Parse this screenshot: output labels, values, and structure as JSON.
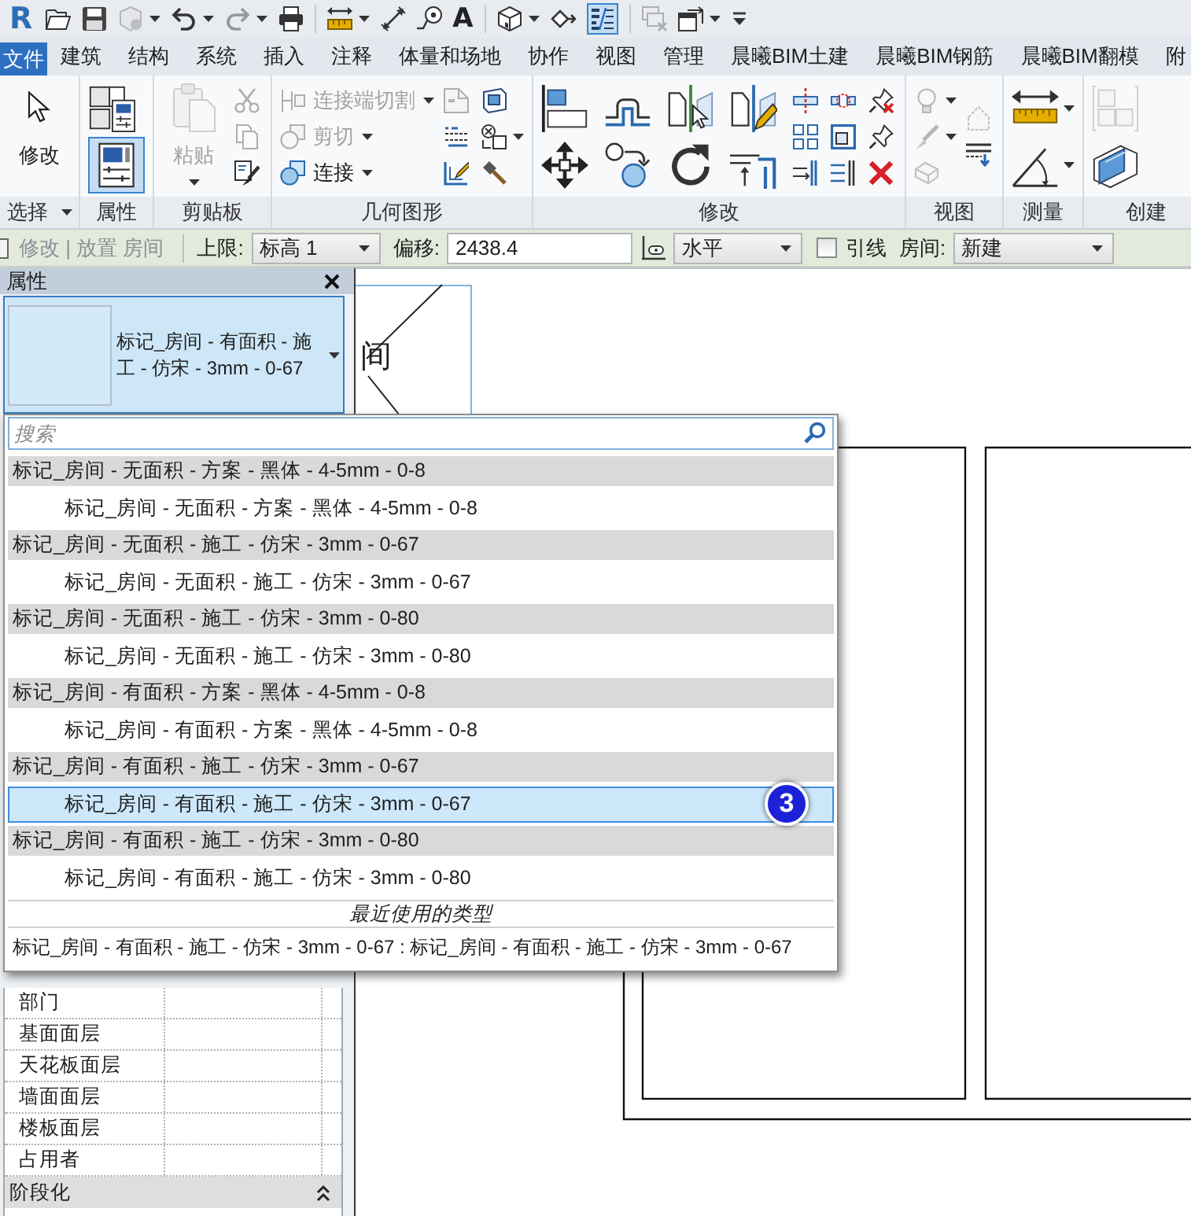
{
  "quick_access_toolbar": {
    "app_glyph": "R",
    "groups": [
      [
        {
          "disabled": false,
          "menu": false,
          "on": false
        },
        {
          "disabled": false,
          "menu": false,
          "on": false
        },
        {
          "disabled": true,
          "menu": true,
          "on": false
        },
        {
          "disabled": false,
          "menu": true,
          "on": false
        },
        {
          "disabled": true,
          "menu": true,
          "on": false
        },
        {
          "disabled": false,
          "menu": false,
          "on": false
        }
      ],
      [
        {
          "disabled": false,
          "menu": true,
          "on": false
        },
        {
          "disabled": false,
          "menu": false,
          "on": false
        },
        {
          "disabled": false,
          "menu": false,
          "on": false
        },
        {
          "glyph": "A",
          "disabled": false,
          "menu": false,
          "on": false
        }
      ],
      [
        {
          "disabled": false,
          "menu": true,
          "on": false
        },
        {
          "disabled": false,
          "menu": false,
          "on": false
        },
        {
          "disabled": false,
          "menu": false,
          "on": true
        }
      ],
      [
        {
          "disabled": true,
          "menu": false,
          "on": false
        },
        {
          "disabled": false,
          "menu": true,
          "on": false
        },
        {
          "disabled": false,
          "menu": false,
          "on": false
        }
      ]
    ]
  },
  "ribbon_tabs": [
    {
      "label": "文件",
      "kind": "application"
    },
    {
      "label": "建筑",
      "kind": "tab"
    },
    {
      "label": "结构",
      "kind": "tab"
    },
    {
      "label": "系统",
      "kind": "tab"
    },
    {
      "label": "插入",
      "kind": "tab"
    },
    {
      "label": "注释",
      "kind": "tab"
    },
    {
      "label": "体量和场地",
      "kind": "tab"
    },
    {
      "label": "协作",
      "kind": "tab"
    },
    {
      "label": "视图",
      "kind": "tab"
    },
    {
      "label": "管理",
      "kind": "tab"
    },
    {
      "label": "晨曦BIM土建",
      "kind": "tab"
    },
    {
      "label": "晨曦BIM钢筋",
      "kind": "tab"
    },
    {
      "label": "晨曦BIM翻模",
      "kind": "tab"
    },
    {
      "label": "附",
      "kind": "tab"
    }
  ],
  "ribbon_panels": [
    {
      "title": "选择",
      "menu": true,
      "tools": [
        {
          "kind": "large",
          "label": "修改",
          "disabled": false,
          "menu": false
        }
      ]
    },
    {
      "title": "属性",
      "menu": false,
      "tools": [
        {
          "kind": "medium",
          "disabled": false,
          "menu": false,
          "on": false
        },
        {
          "kind": "medium",
          "disabled": false,
          "menu": false,
          "on": true
        }
      ]
    },
    {
      "title": "剪贴板",
      "menu": false,
      "tools": [
        {
          "kind": "large",
          "label": "粘贴",
          "disabled": true,
          "menu": true
        },
        {
          "kind": "small",
          "disabled": true,
          "menu": false
        },
        {
          "kind": "small",
          "disabled": true,
          "menu": false
        },
        {
          "kind": "small",
          "disabled": false,
          "menu": false
        }
      ]
    },
    {
      "title": "几何图形",
      "menu": false,
      "tools": [
        {
          "kind": "small",
          "label": "连接端切割",
          "disabled": true,
          "menu": true
        },
        {
          "kind": "small",
          "label": "剪切",
          "disabled": true,
          "menu": true
        },
        {
          "kind": "small",
          "label": "连接",
          "disabled": false,
          "menu": true
        },
        {
          "kind": "small",
          "disabled": true,
          "menu": false
        },
        {
          "kind": "small",
          "disabled": false,
          "menu": false
        },
        {
          "kind": "small",
          "disabled": false,
          "menu": false
        },
        {
          "kind": "small",
          "disabled": false,
          "menu": false
        },
        {
          "kind": "small",
          "disabled": false,
          "menu": true
        },
        {
          "kind": "small",
          "disabled": false,
          "menu": false
        }
      ]
    },
    {
      "title": "修改",
      "menu": false,
      "tools": [
        {
          "kind": "medium",
          "disabled": false,
          "menu": false
        },
        {
          "kind": "medium",
          "disabled": false,
          "menu": false
        },
        {
          "kind": "medium",
          "disabled": false,
          "menu": false
        },
        {
          "kind": "medium",
          "disabled": false,
          "menu": false
        },
        {
          "kind": "medium",
          "disabled": false,
          "menu": false
        },
        {
          "kind": "medium",
          "disabled": false,
          "menu": false
        },
        {
          "kind": "medium",
          "disabled": false,
          "menu": false
        },
        {
          "kind": "medium",
          "disabled": false,
          "menu": false
        },
        {
          "kind": "small",
          "disabled": false,
          "menu": false
        },
        {
          "kind": "small",
          "disabled": false,
          "menu": false
        },
        {
          "kind": "small",
          "disabled": false,
          "menu": false
        },
        {
          "kind": "small",
          "disabled": false,
          "menu": false
        },
        {
          "kind": "small",
          "disabled": false,
          "menu": false
        },
        {
          "kind": "small",
          "disabled": false,
          "menu": false
        },
        {
          "kind": "small",
          "disabled": false,
          "menu": false
        },
        {
          "kind": "small",
          "disabled": false,
          "menu": false
        },
        {
          "kind": "small",
          "disabled": false,
          "menu": false
        }
      ]
    },
    {
      "title": "视图",
      "menu": false,
      "tools": [
        {
          "kind": "small",
          "disabled": true,
          "menu": true
        },
        {
          "kind": "small",
          "disabled": true,
          "menu": true
        },
        {
          "kind": "small",
          "disabled": true,
          "menu": false
        },
        {
          "kind": "small",
          "disabled": true,
          "menu": false
        },
        {
          "kind": "small",
          "disabled": false,
          "menu": false
        }
      ]
    },
    {
      "title": "测量",
      "menu": false,
      "tools": [
        {
          "kind": "medium",
          "disabled": false,
          "menu": true
        },
        {
          "kind": "medium",
          "disabled": false,
          "menu": true
        }
      ]
    },
    {
      "title": "创建",
      "menu": false,
      "tools": [
        {
          "kind": "medium",
          "disabled": true,
          "menu": false
        },
        {
          "kind": "medium",
          "disabled": false,
          "menu": false
        }
      ]
    }
  ],
  "options_bar": {
    "context": "修改 | 放置 房间",
    "controls": [
      {
        "kind": "dropdown",
        "label": "上限:",
        "value": "标高 1"
      },
      {
        "kind": "input",
        "label": "偏移:",
        "value": "2438.4"
      },
      {
        "kind": "icon-dropdown",
        "value": "水平"
      },
      {
        "kind": "checkbox",
        "label": "引线",
        "checked": false
      },
      {
        "kind": "dropdown",
        "label": "房间:",
        "value": "新建"
      }
    ]
  },
  "properties": {
    "title": "属性",
    "type_selector": {
      "text": "标记_房间 - 有面积 - 施工 - 仿宋 - 3mm - 0-67",
      "expanded": true,
      "search": {
        "placeholder": "搜索"
      },
      "families": [
        {
          "label": "标记_房间 - 无面积 - 方案 - 黑体 - 4-5mm - 0-8",
          "types": [
            {
              "label": "标记_房间 - 无面积 - 方案 - 黑体 - 4-5mm - 0-8",
              "selected": false
            }
          ]
        },
        {
          "label": "标记_房间 - 无面积 - 施工 - 仿宋 - 3mm - 0-67",
          "types": [
            {
              "label": "标记_房间 - 无面积 - 施工 - 仿宋 - 3mm - 0-67",
              "selected": false
            }
          ]
        },
        {
          "label": "标记_房间 - 无面积 - 施工 - 仿宋 - 3mm - 0-80",
          "types": [
            {
              "label": "标记_房间 - 无面积 - 施工 - 仿宋 - 3mm - 0-80",
              "selected": false
            }
          ]
        },
        {
          "label": "标记_房间 - 有面积 - 方案 - 黑体 - 4-5mm - 0-8",
          "types": [
            {
              "label": "标记_房间 - 有面积 - 方案 - 黑体 - 4-5mm - 0-8",
              "selected": false
            }
          ]
        },
        {
          "label": "标记_房间 - 有面积 - 施工 - 仿宋 - 3mm - 0-67",
          "types": [
            {
              "label": "标记_房间 - 有面积 - 施工 - 仿宋 - 3mm - 0-67",
              "selected": true,
              "callout": "3"
            }
          ]
        },
        {
          "label": "标记_房间 - 有面积 - 施工 - 仿宋 - 3mm - 0-80",
          "types": [
            {
              "label": "标记_房间 - 有面积 - 施工 - 仿宋 - 3mm - 0-80",
              "selected": false
            }
          ]
        }
      ],
      "recent": {
        "header": "最近使用的类型",
        "items": [
          "标记_房间 - 有面积 - 施工 - 仿宋 - 3mm - 0-67 : 标记_房间 - 有面积 - 施工 - 仿宋 - 3mm - 0-67"
        ]
      }
    },
    "rows": [
      {
        "kind": "parameter",
        "label": "部门"
      },
      {
        "kind": "parameter",
        "label": "基面面层"
      },
      {
        "kind": "parameter",
        "label": "天花板面层"
      },
      {
        "kind": "parameter",
        "label": "墙面面层"
      },
      {
        "kind": "parameter",
        "label": "楼板面层"
      },
      {
        "kind": "parameter",
        "label": "占用者"
      },
      {
        "kind": "group",
        "label": "阶段化",
        "expanded": true
      }
    ]
  },
  "canvas": {
    "tag_text": "间"
  }
}
